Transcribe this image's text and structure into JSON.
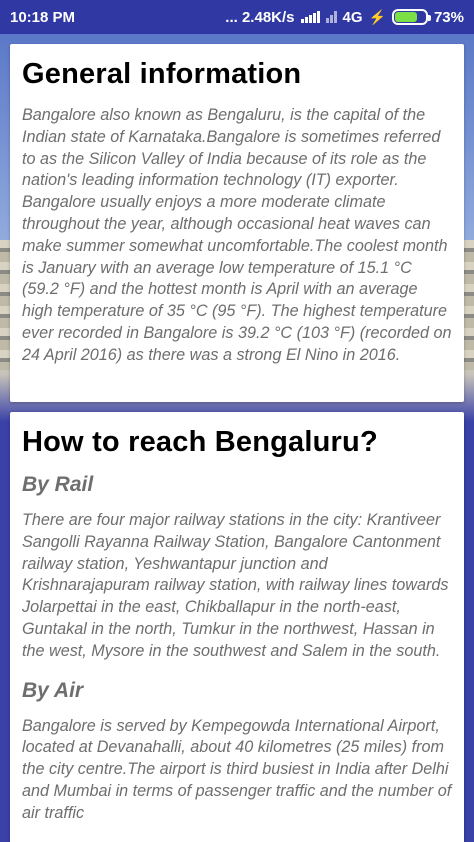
{
  "status_bar": {
    "time": "10:18 PM",
    "speed": "... 2.48K/s",
    "network": "4G",
    "battery_percent_label": "73%",
    "battery_level": 0.73
  },
  "general": {
    "title": "General information",
    "body": "Bangalore also known as Bengaluru, is the capital of the Indian state of Karnataka.Bangalore is sometimes referred to as the Silicon Valley of India because of its role as the nation's leading information technology (IT) exporter. Bangalore usually enjoys a more moderate climate throughout the year, although occasional heat waves can make summer somewhat uncomfortable.The coolest month is January with an average low temperature of 15.1 °C (59.2 °F) and the hottest month is April with an average high temperature of 35 °C (95 °F). The highest temperature ever recorded in Bangalore is 39.2 °C (103 °F) (recorded on 24 April 2016) as there was a strong El Nino in 2016."
  },
  "reach": {
    "title": "How to reach Bengaluru?",
    "rail_heading": "By Rail",
    "rail_body": "There are four major railway stations in the city: Krantiveer Sangolli Rayanna Railway Station, Bangalore Cantonment railway station, Yeshwantapur junction and Krishnarajapuram railway station, with railway lines towards Jolarpettai in the east, Chikballapur in the north-east, Guntakal in the north, Tumkur in the northwest, Hassan in the west, Mysore in the southwest and Salem in the south.",
    "air_heading": "By Air",
    "air_body": "Bangalore is served by Kempegowda International Airport, located at Devanahalli, about 40 kilometres (25 miles) from the city centre.The airport is third busiest in India after Delhi and Mumbai in terms of passenger traffic and the number of air traffic"
  }
}
